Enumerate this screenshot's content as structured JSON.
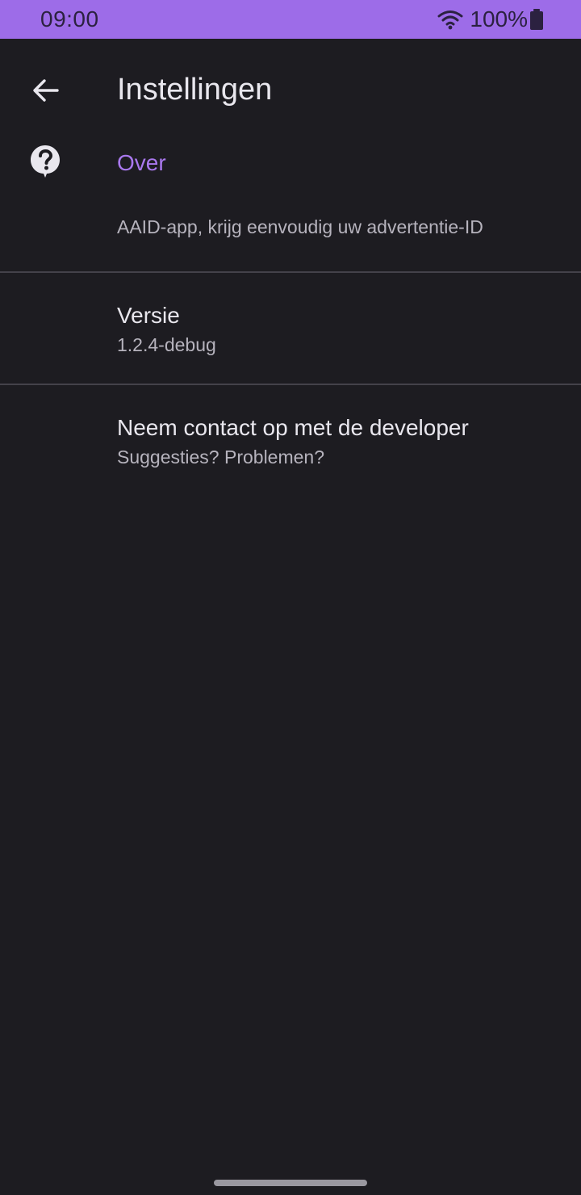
{
  "status_bar": {
    "time": "09:00",
    "battery": "100%",
    "icons": [
      "wifi-icon",
      "battery-icon"
    ]
  },
  "toolbar": {
    "title": "Instellingen",
    "back_icon": "arrow-back-icon"
  },
  "about_section": {
    "icon": "help-bubble-icon",
    "title": "Over",
    "summary": "AAID-app, krijg eenvoudig uw advertentie-ID"
  },
  "preferences": [
    {
      "title": "Versie",
      "summary": "1.2.4-debug"
    },
    {
      "title": "Neem contact op met de developer",
      "summary": "Suggesties? Problemen?"
    }
  ],
  "colors": {
    "status_bar": "#9d6ce8",
    "background": "#1d1c21",
    "accent": "#a978ee",
    "primary_text": "#e9e7ee",
    "secondary_text": "#b6b3bd"
  }
}
